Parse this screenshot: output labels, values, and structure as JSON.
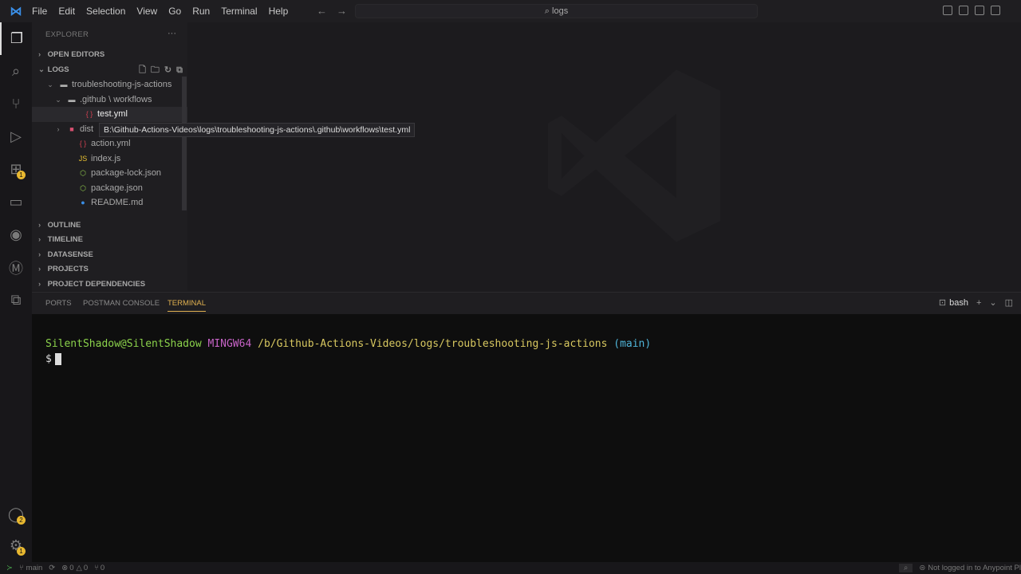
{
  "menu": [
    "File",
    "Edit",
    "Selection",
    "View",
    "Go",
    "Run",
    "Terminal",
    "Help"
  ],
  "search": "logs",
  "explorer": {
    "title": "EXPLORER",
    "open_editors": "OPEN EDITORS",
    "logs": "LOGS",
    "tree": [
      {
        "label": "troubleshooting-js-actions",
        "icon": "folder-open-icon",
        "glyph": "▬",
        "color": "#b0b0b0",
        "indent": 48,
        "chev": "⌄"
      },
      {
        "label": ".github \\ workflows",
        "icon": "folder-open-icon",
        "glyph": "▬",
        "color": "#b0b0b0",
        "indent": 58,
        "chev": "⌄"
      },
      {
        "label": "test.yml",
        "icon": "yaml-icon",
        "glyph": "{ }",
        "color": "#d04050",
        "indent": 80,
        "chev": "",
        "selected": true
      },
      {
        "label": "dist",
        "icon": "folder-icon",
        "glyph": "■",
        "color": "#d85070",
        "indent": 58,
        "chev": "›"
      },
      {
        "label": "action.yml",
        "icon": "yaml-icon",
        "glyph": "{ }",
        "color": "#d04050",
        "indent": 72,
        "chev": ""
      },
      {
        "label": "index.js",
        "icon": "js-icon",
        "glyph": "JS",
        "color": "#e8c030",
        "indent": 72,
        "chev": ""
      },
      {
        "label": "package-lock.json",
        "icon": "npm-icon",
        "glyph": "⬡",
        "color": "#8bc34a",
        "indent": 72,
        "chev": ""
      },
      {
        "label": "package.json",
        "icon": "npm-icon",
        "glyph": "⬡",
        "color": "#8bc34a",
        "indent": 72,
        "chev": ""
      },
      {
        "label": "README.md",
        "icon": "info-icon",
        "glyph": "●",
        "color": "#3a8ee6",
        "indent": 72,
        "chev": ""
      }
    ],
    "sections": [
      "OUTLINE",
      "TIMELINE",
      "DATASENSE",
      "PROJECTS",
      "PROJECT DEPENDENCIES"
    ]
  },
  "tooltip": "B:\\Github-Actions-Videos\\logs\\troubleshooting-js-actions\\.github\\workflows\\test.yml",
  "panel": {
    "tabs": [
      "PORTS",
      "POSTMAN CONSOLE",
      "TERMINAL"
    ],
    "shell": "bash"
  },
  "terminal": {
    "user": "SilentShadow@SilentShadow",
    "env": "MINGW64",
    "path": "/b/Github-Actions-Videos/logs/troubleshooting-js-actions",
    "branch": "(main)",
    "prompt": "$"
  },
  "activity_badges": {
    "extensions": "1",
    "accounts": "2",
    "settings": "1"
  },
  "status": {
    "branch": "main",
    "errors": "0",
    "warnings": "0",
    "ports": "0",
    "anypoint": "Not logged in to Anypoint Pl"
  }
}
